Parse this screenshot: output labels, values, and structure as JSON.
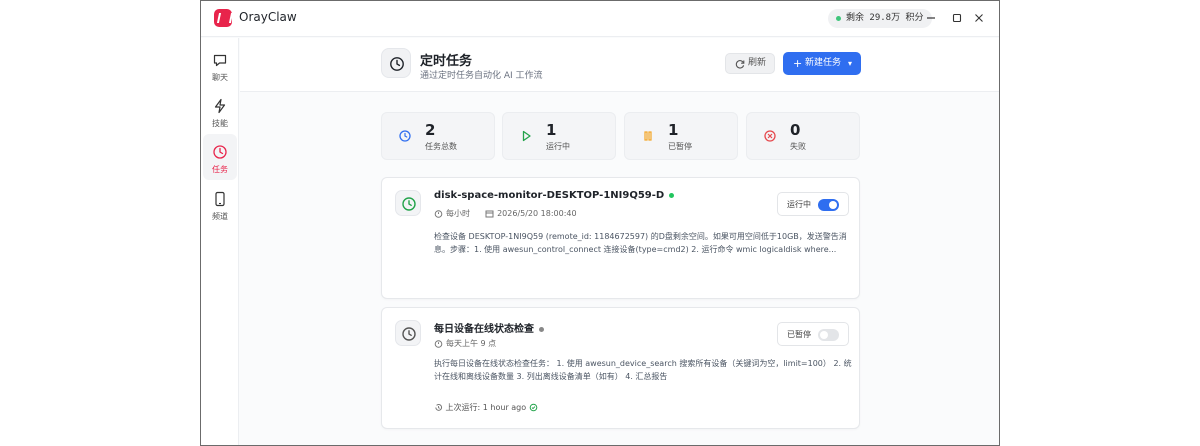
{
  "app": {
    "title": "OrayClaw",
    "brand_color": "#e8244b"
  },
  "titlebar": {
    "balance": "剩余 29.8万 积分"
  },
  "sidebar": {
    "items": [
      {
        "label": "聊天",
        "icon": "chat-icon"
      },
      {
        "label": "技能",
        "icon": "lightning-icon"
      },
      {
        "label": "任务",
        "icon": "clock-icon",
        "active": true
      },
      {
        "label": "频道",
        "icon": "device-icon"
      }
    ]
  },
  "header": {
    "title": "定时任务",
    "subtitle": "通过定时任务自动化 AI 工作流",
    "refresh_label": "刷新",
    "new_task_label": "新建任务"
  },
  "stats": [
    {
      "value": "2",
      "label": "任务总数",
      "icon": "clock-icon",
      "color": "#2f6ef0"
    },
    {
      "value": "1",
      "label": "运行中",
      "icon": "play-icon",
      "color": "#22a34a"
    },
    {
      "value": "1",
      "label": "已暂停",
      "icon": "pause-icon",
      "color": "#f5a524"
    },
    {
      "value": "0",
      "label": "失败",
      "icon": "error-icon",
      "color": "#e5484d"
    }
  ],
  "tasks": [
    {
      "name": "disk-space-monitor-DESKTOP-1NI9Q59-D",
      "status_color": "#22c55e",
      "schedule": "每小时",
      "next_run": "2026/5/20 18:00:40",
      "description": "检查设备 DESKTOP-1NI9Q59 (remote_id: 1184672597) 的D盘剩余空间。如果可用空间低于10GB，发送警告消息。步骤：1. 使用 awesun_control_connect 连接设备(type=cmd2) 2. 运行命令 wmic logicaldisk where...",
      "toggle_label": "运行中",
      "enabled": true
    },
    {
      "name": "每日设备在线状态检查",
      "status_color": "#888888",
      "schedule": "每天上午 9 点",
      "description": "执行每日设备在线状态检查任务： 1. 使用 awesun_device_search 搜索所有设备（关键词为空，limit=100） 2. 统计在线和离线设备数量 3. 列出离线设备清单（如有） 4. 汇总报告",
      "toggle_label": "已暂停",
      "enabled": false,
      "last_run": "上次运行: 1 hour ago"
    }
  ]
}
